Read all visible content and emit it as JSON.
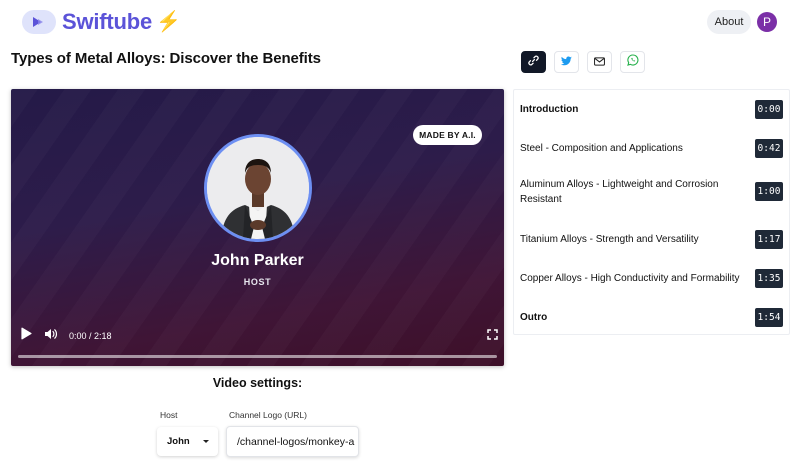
{
  "app": {
    "name": "Swiftube",
    "brand_color": "#5b53d8",
    "about_label": "About",
    "user_initial": "P"
  },
  "page": {
    "title": "Types of Metal Alloys: Discover the Benefits"
  },
  "share_buttons": [
    {
      "icon": "link-icon",
      "active": true
    },
    {
      "icon": "twitter-icon",
      "active": false
    },
    {
      "icon": "mail-icon",
      "active": false
    },
    {
      "icon": "whatsapp-icon",
      "active": false
    }
  ],
  "video": {
    "badge": "MADE BY A.I.",
    "host_name": "John Parker",
    "host_role": "HOST",
    "time": "0:00 / 2:18",
    "progress": 0,
    "controls": [
      "play-icon",
      "volume-icon",
      "fullscreen-icon"
    ]
  },
  "chapters": [
    {
      "title": "Introduction",
      "time": "0:00",
      "bold": true
    },
    {
      "title": "Steel - Composition and Applications",
      "time": "0:42",
      "bold": false
    },
    {
      "title": "Aluminum Alloys - Lightweight and Corrosion Resistant",
      "time": "1:00",
      "bold": false
    },
    {
      "title": "Titanium Alloys - Strength and Versatility",
      "time": "1:17",
      "bold": false
    },
    {
      "title": "Copper Alloys - High Conductivity and Formability",
      "time": "1:35",
      "bold": false
    },
    {
      "title": "Outro",
      "time": "1:54",
      "bold": true
    }
  ],
  "settings": {
    "title": "Video settings:",
    "host_label": "Host",
    "host_value": "John",
    "logo_label": "Channel Logo (URL)",
    "logo_value": "/channel-logos/monkey-a"
  }
}
